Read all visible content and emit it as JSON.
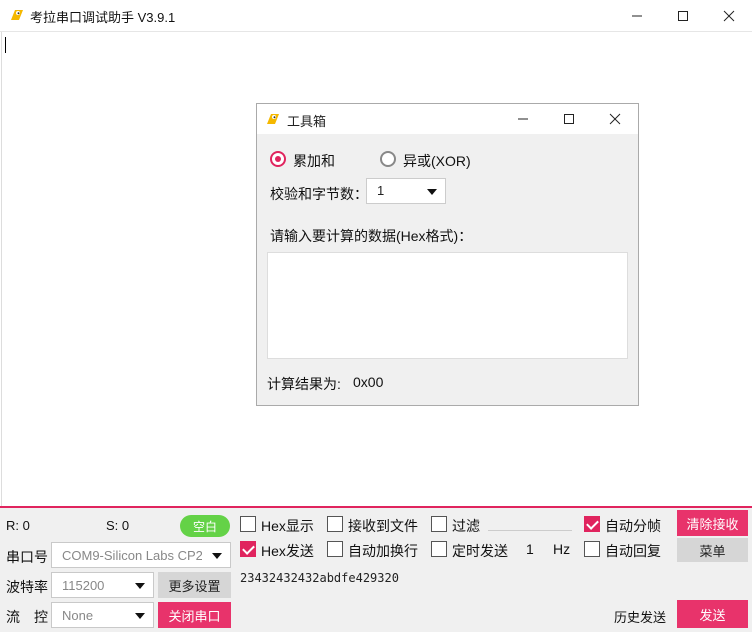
{
  "window": {
    "title": "考拉串口调试助手 V3.9.1"
  },
  "toolbox": {
    "title": "工具箱",
    "radio_sum": "累加和",
    "radio_xor": "异或(XOR)",
    "bytes_label": "校验和字节数：",
    "bytes_value": "1",
    "input_label": "请输入要计算的数据(Hex格式)：",
    "input_value": "",
    "result_label": "计算结果为:",
    "result_value": "0x00"
  },
  "status": {
    "r_label": "R: 0",
    "s_label": "S: 0",
    "badge": "空白"
  },
  "port": {
    "port_label": "串口号",
    "port_value": "COM9-Silicon Labs CP2",
    "baud_label": "波特率",
    "baud_value": "115200",
    "flow_label": "流　控",
    "flow_value": "None",
    "more_settings": "更多设置",
    "close_port": "关闭串口"
  },
  "options": {
    "hex_display": "Hex显示",
    "recv_to_file": "接收到文件",
    "filter": "过滤",
    "auto_frame": "自动分帧",
    "hex_send": "Hex发送",
    "auto_newline": "自动加换行",
    "timed_send": "定时发送",
    "timed_value": "1",
    "hz": "Hz",
    "auto_reply": "自动回复"
  },
  "buttons": {
    "clear_recv": "清除接收",
    "menu": "菜单",
    "history": "历史发送",
    "send": "发送"
  },
  "send_text": "23432432432abdfe429320",
  "colors": {
    "accent": "#e8336b",
    "badge": "#64d247"
  }
}
